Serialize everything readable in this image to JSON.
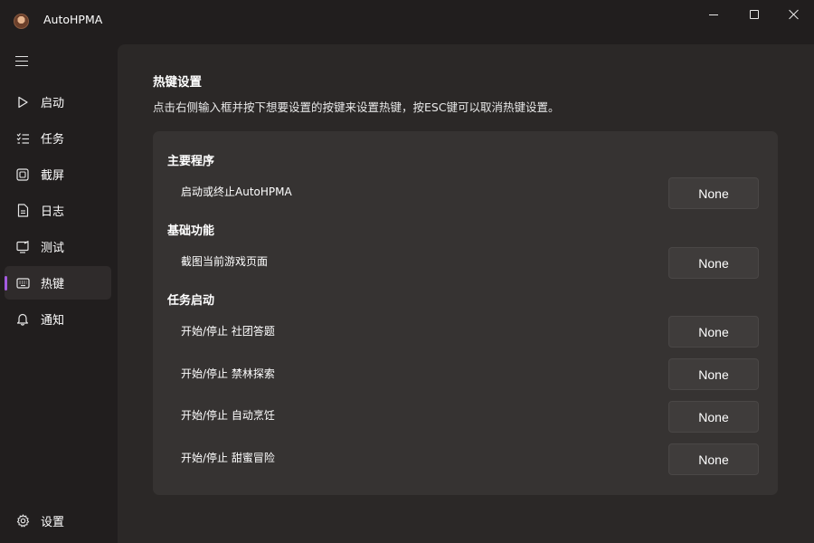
{
  "window": {
    "title": "AutoHPMA"
  },
  "sidebar": {
    "items": [
      {
        "label": "启动",
        "icon": "play-icon"
      },
      {
        "label": "任务",
        "icon": "checklist-icon"
      },
      {
        "label": "截屏",
        "icon": "screenshot-icon"
      },
      {
        "label": "日志",
        "icon": "document-icon"
      },
      {
        "label": "测试",
        "icon": "monitor-test-icon"
      },
      {
        "label": "热键",
        "icon": "keyboard-icon",
        "active": true
      },
      {
        "label": "通知",
        "icon": "bell-icon"
      }
    ],
    "footer": {
      "label": "设置",
      "icon": "gear-icon"
    }
  },
  "page": {
    "title": "热键设置",
    "description": "点击右侧输入框并按下想要设置的按键来设置热键，按ESC键可以取消热键设置。"
  },
  "sections": [
    {
      "title": "主要程序",
      "rows": [
        {
          "label": "启动或终止AutoHPMA",
          "value": "None"
        }
      ]
    },
    {
      "title": "基础功能",
      "rows": [
        {
          "label": "截图当前游戏页面",
          "value": "None"
        }
      ]
    },
    {
      "title": "任务启动",
      "rows": [
        {
          "label": "开始/停止 社团答题",
          "value": "None"
        },
        {
          "label": "开始/停止 禁林探索",
          "value": "None"
        },
        {
          "label": "开始/停止 自动烹饪",
          "value": "None"
        },
        {
          "label": "开始/停止 甜蜜冒险",
          "value": "None"
        }
      ]
    }
  ],
  "colors": {
    "accent": "#a45be0",
    "background": "#211e1e",
    "panel": "#2b2827",
    "card": "#363332"
  }
}
